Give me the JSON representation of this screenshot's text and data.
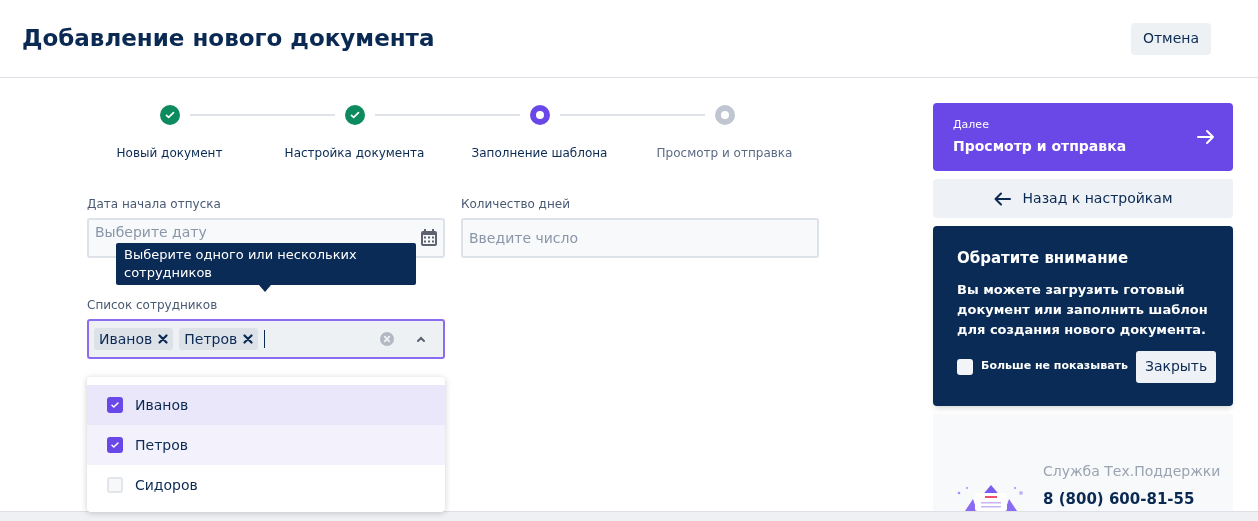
{
  "header": {
    "title": "Добавление нового документа",
    "cancel_button": "Отмена"
  },
  "steps": [
    {
      "label": "Новый документ",
      "done": true,
      "selected": false
    },
    {
      "label": "Настройка документа",
      "done": true,
      "selected": false
    },
    {
      "label": "Заполнение шаблона",
      "done": false,
      "selected": true
    },
    {
      "label": "Просмотр и отправка",
      "done": false,
      "selected": false
    }
  ],
  "fields": [
    {
      "label": "Дата начала отпуска",
      "placeholder": "Выберите дату",
      "kind": "date"
    },
    {
      "label": "Количество дней",
      "placeholder": "Введите число",
      "kind": "number"
    }
  ],
  "tooltip": {
    "text": "Выберите одного или нескольких сотрудников"
  },
  "employees": {
    "label": "Список сотрудников",
    "expanded": true,
    "tags": [
      {
        "label": "Иванов"
      },
      {
        "label": "Петров"
      }
    ],
    "options": [
      {
        "label": "Иванов",
        "checked": true
      },
      {
        "label": "Петров",
        "checked": true
      },
      {
        "label": "Сидоров",
        "checked": false
      }
    ]
  },
  "sidebar": {
    "next_button": {
      "caption": "Далее",
      "label": "Просмотр и отправка"
    },
    "back_button": "Назад к настройкам",
    "notice": {
      "title": "Обратите внимание",
      "text": "Вы можете загрузить готовый документ или заполнить шаблон для создания нового документа.",
      "checkbox": {
        "label": "Больше не показывать",
        "checked": false
      },
      "close_button": "Закрыть"
    },
    "support": {
      "title": "Служба Тех.Поддержки",
      "phone": "8 (800) 600-81-55"
    }
  }
}
